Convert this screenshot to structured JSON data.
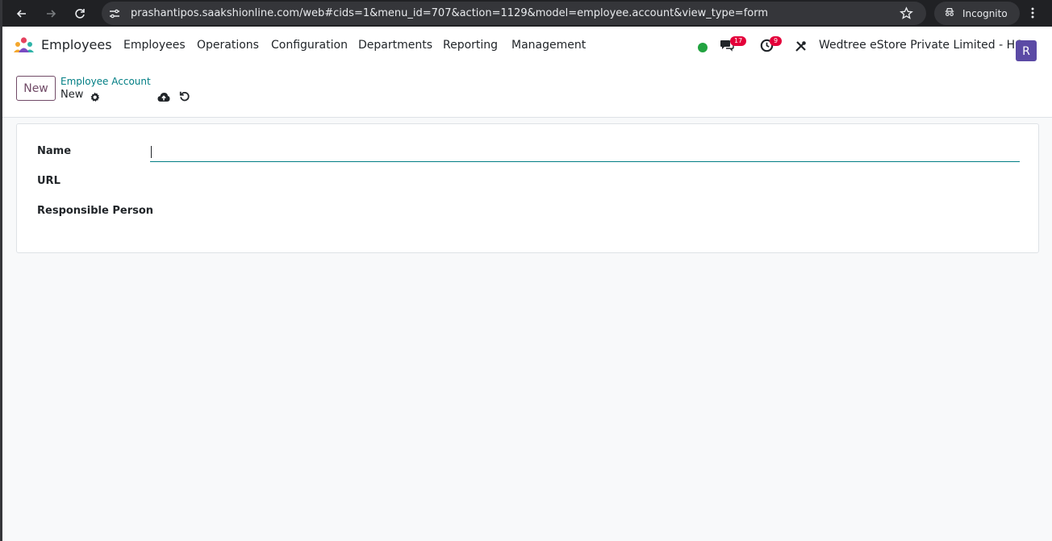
{
  "browser": {
    "url": "prashantipos.saakshionline.com/web#cids=1&menu_id=707&action=1129&model=employee.account&view_type=form",
    "incognito_label": "Incognito"
  },
  "topbar": {
    "app_name": "Employees",
    "menu": [
      "Employees",
      "Operations",
      "Configuration",
      "Departments",
      "Reporting",
      "Management"
    ],
    "messages_count": "17",
    "activities_count": "9",
    "company": "Wedtree eStore Private Limited - HO",
    "avatar_letter": "R",
    "status_color": "#28a745",
    "badge_color": "#e4003a",
    "avatar_color": "#5b4aa5"
  },
  "controlbar": {
    "new_label": "New",
    "breadcrumb": "Employee Account",
    "record_name": "New"
  },
  "form": {
    "fields": [
      {
        "label": "Name",
        "value": ""
      },
      {
        "label": "URL",
        "value": ""
      },
      {
        "label": "Responsible Person",
        "value": ""
      }
    ]
  },
  "colors": {
    "accent": "#714b67",
    "link": "#017e84"
  }
}
